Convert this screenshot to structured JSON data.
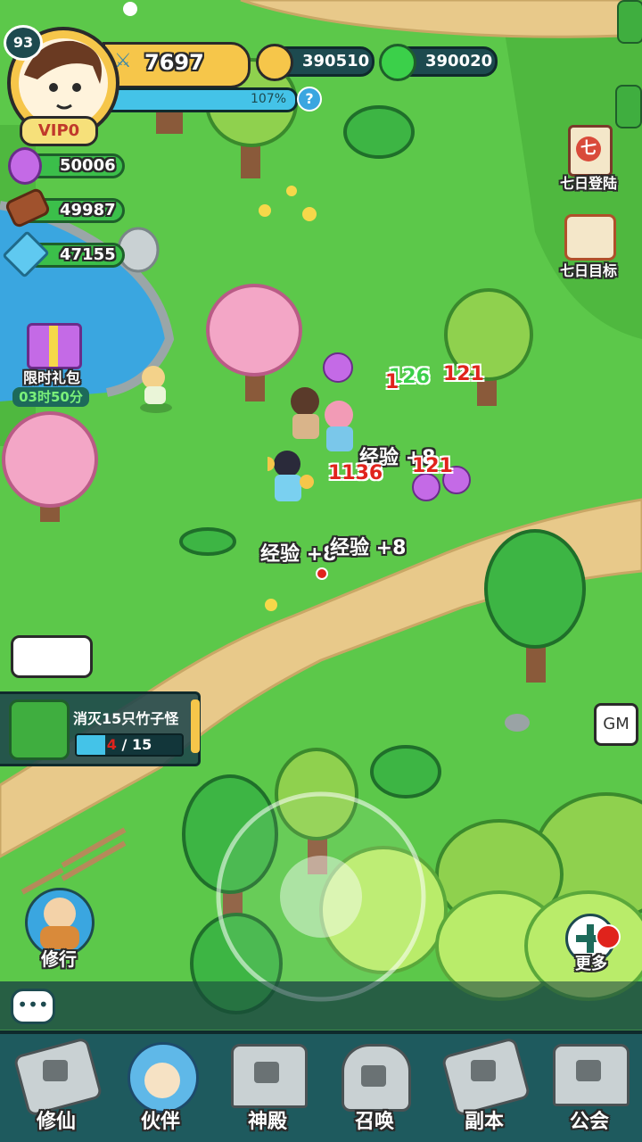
{
  "player": {
    "level": "93",
    "vip": "VIP0",
    "power": "7697",
    "exp_percent": "107%"
  },
  "currencies": {
    "gold": "390510",
    "jade": "390020"
  },
  "resources": {
    "spirit": "50006",
    "wood": "49987",
    "crystal": "47155"
  },
  "side_buttons": {
    "seven_day_login": "七日登陆",
    "seven_day_target": "七日目标",
    "seven_icon_char": "七"
  },
  "gift": {
    "label": "限时礼包",
    "timer": "03时50分"
  },
  "quest": {
    "title": "消灭15只竹子怪",
    "progress_current": "4",
    "progress_sep": "/",
    "progress_total": "15",
    "progress_fraction": 0.27
  },
  "battle_text": {
    "exp1": "经验 +8",
    "exp2": "经验 +8",
    "exp3": "经验 +8",
    "dmg1": "121",
    "dmg2": "1136",
    "dmg3": "121",
    "dmg4": "126",
    "dmg5": "1"
  },
  "buttons": {
    "gm": "GM",
    "cultivate": "修行",
    "more": "更多"
  },
  "nav": [
    {
      "label": "修仙",
      "locked": true
    },
    {
      "label": "伙伴",
      "locked": false
    },
    {
      "label": "神殿",
      "locked": true
    },
    {
      "label": "召唤",
      "locked": true
    },
    {
      "label": "副本",
      "locked": true
    },
    {
      "label": "公会",
      "locked": true
    }
  ],
  "colors": {
    "grass": "#5cc84a",
    "path": "#e8c98a",
    "water": "#3aa6e0",
    "nav_bg": "#1e5a5e",
    "power_bar": "#f6c64a",
    "exp_bar": "#44c3e8"
  }
}
